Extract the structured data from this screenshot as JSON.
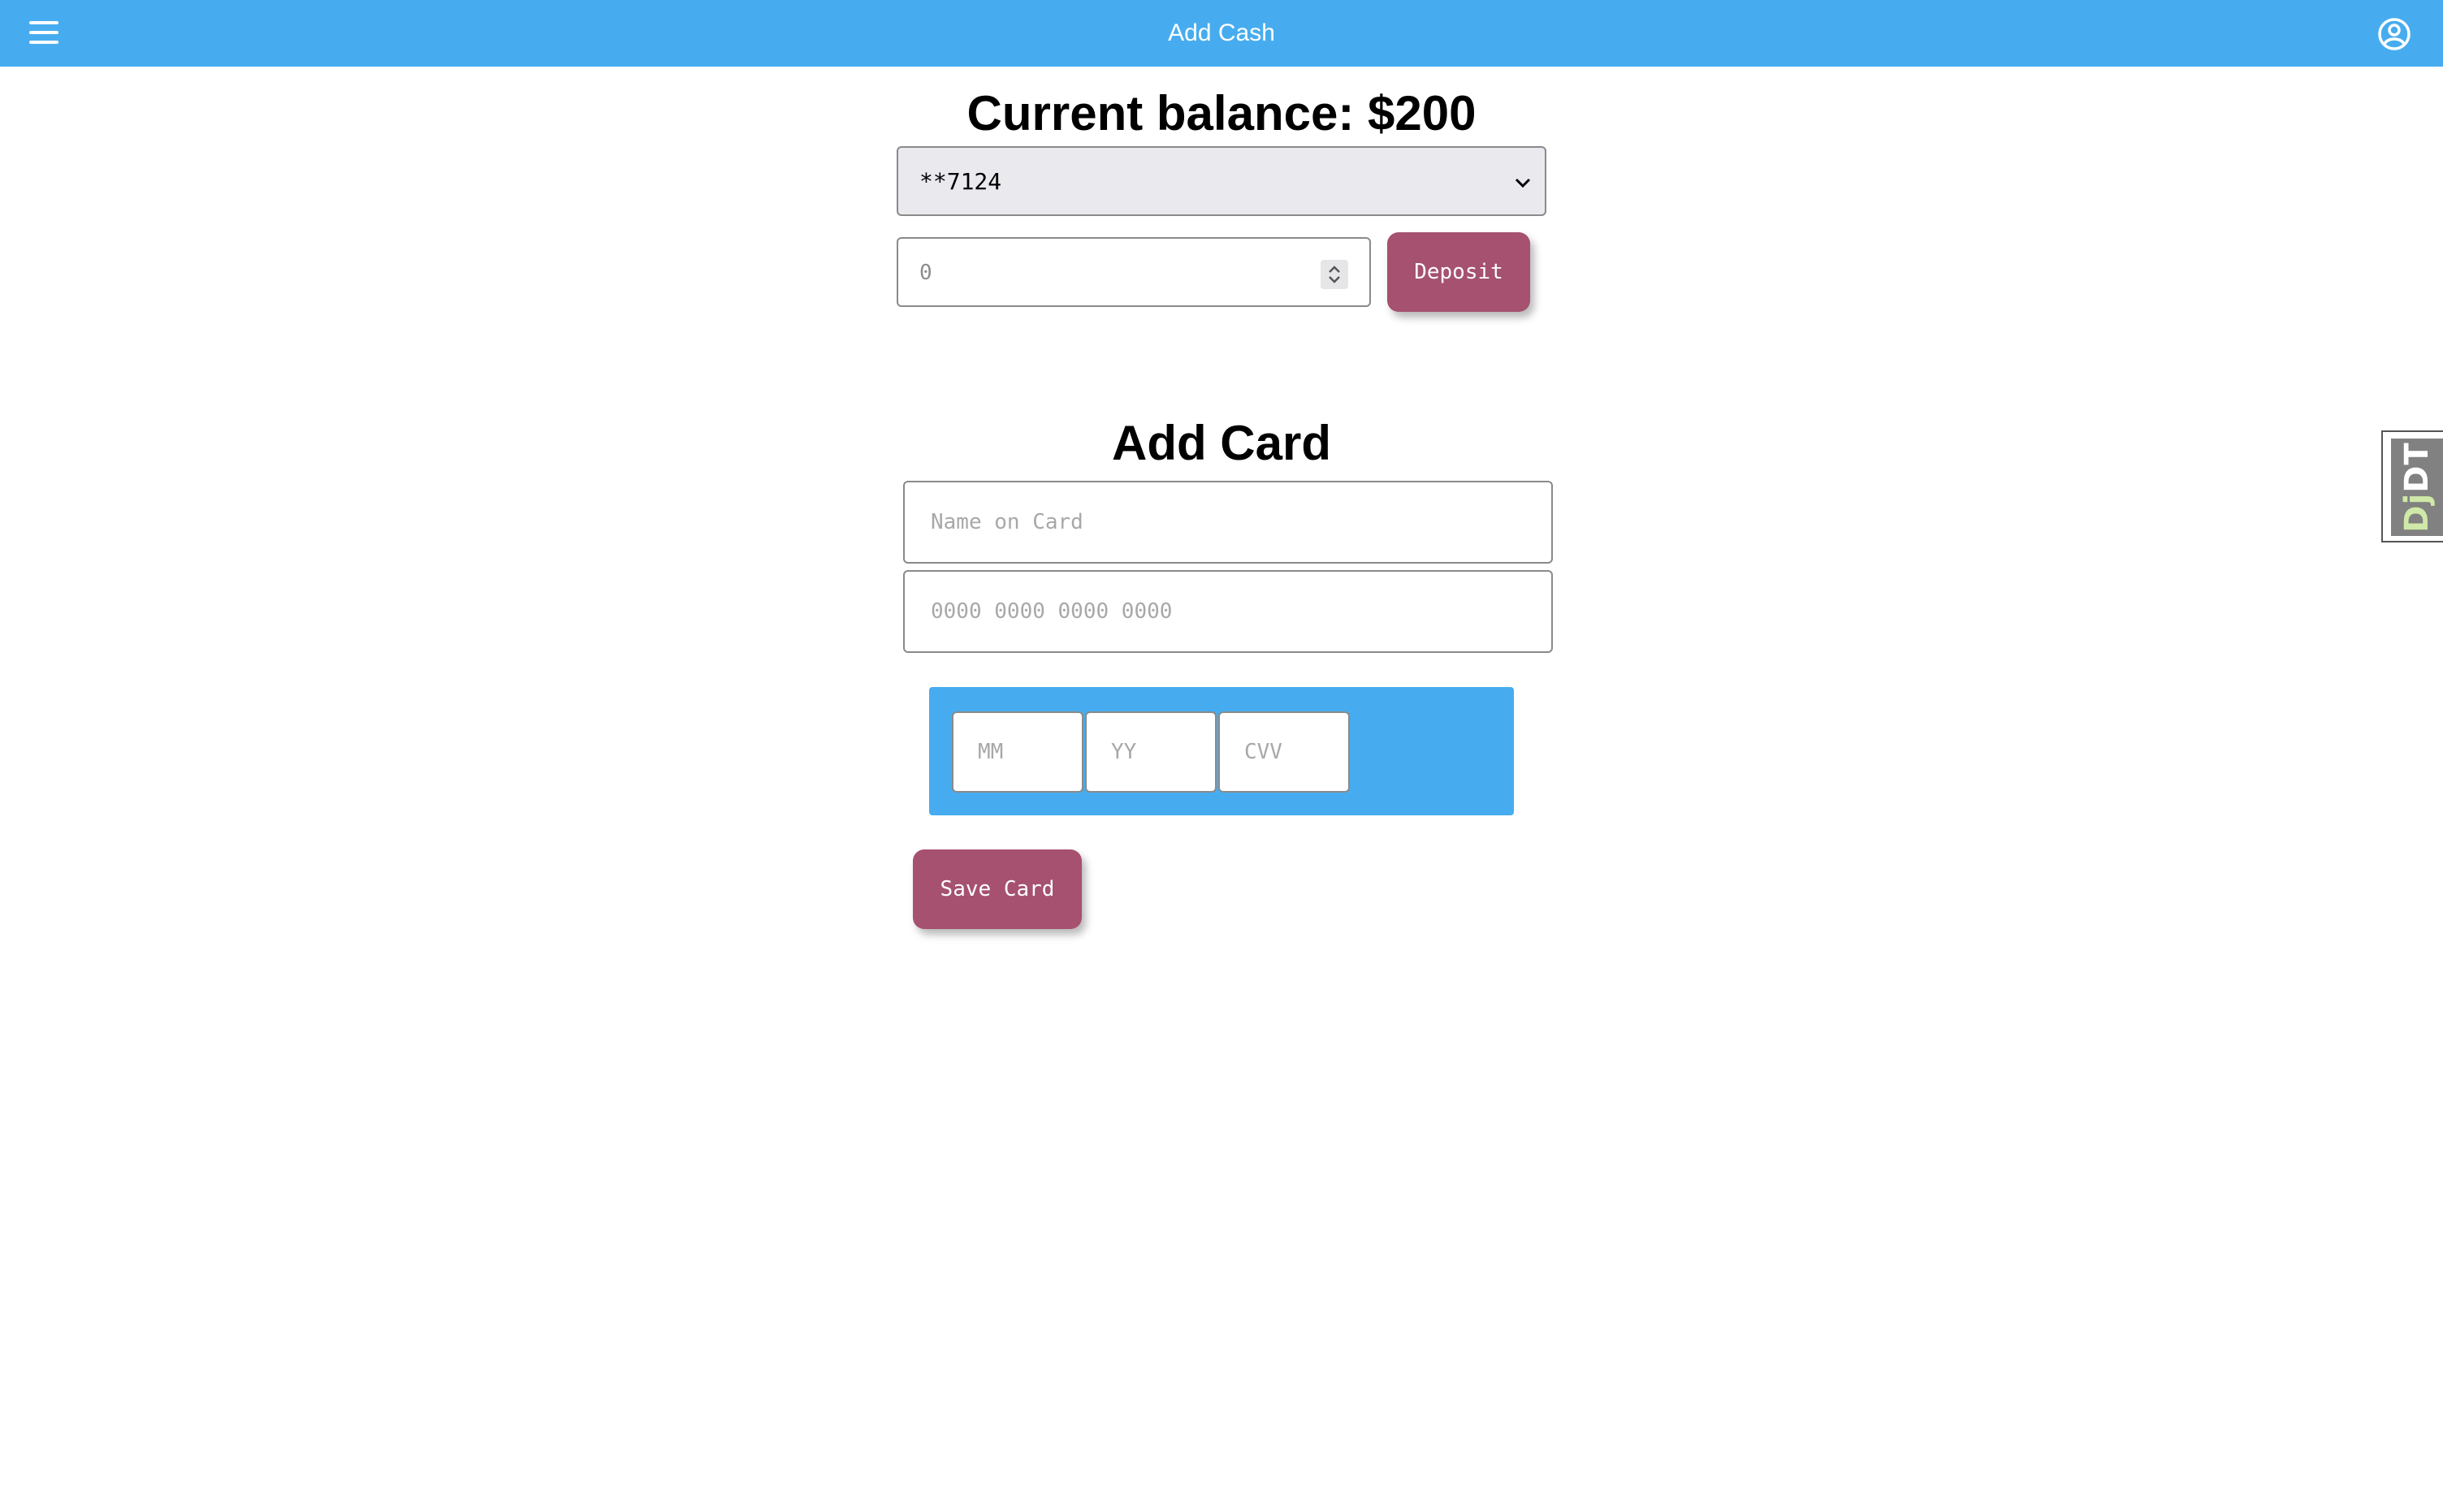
{
  "app_bar": {
    "title": "Add Cash",
    "menu_icon": "hamburger-menu-icon",
    "account_icon": "account-circle-icon",
    "color": "#47acef"
  },
  "balance": {
    "heading": "Current balance: $200"
  },
  "account_select": {
    "selected": "**7124",
    "icon": "chevron-down-icon"
  },
  "deposit": {
    "amount_placeholder": "0",
    "button_label": "Deposit",
    "button_color": "#a5516f"
  },
  "add_card": {
    "heading": "Add Card",
    "name_placeholder": "Name on Card",
    "number_placeholder": "0000 0000 0000 0000",
    "month_placeholder": "MM",
    "year_placeholder": "YY",
    "cvv_placeholder": "CVV",
    "save_label": "Save Card"
  },
  "debug_toolbar": {
    "prefix": "Dj",
    "suffix": "DT"
  }
}
